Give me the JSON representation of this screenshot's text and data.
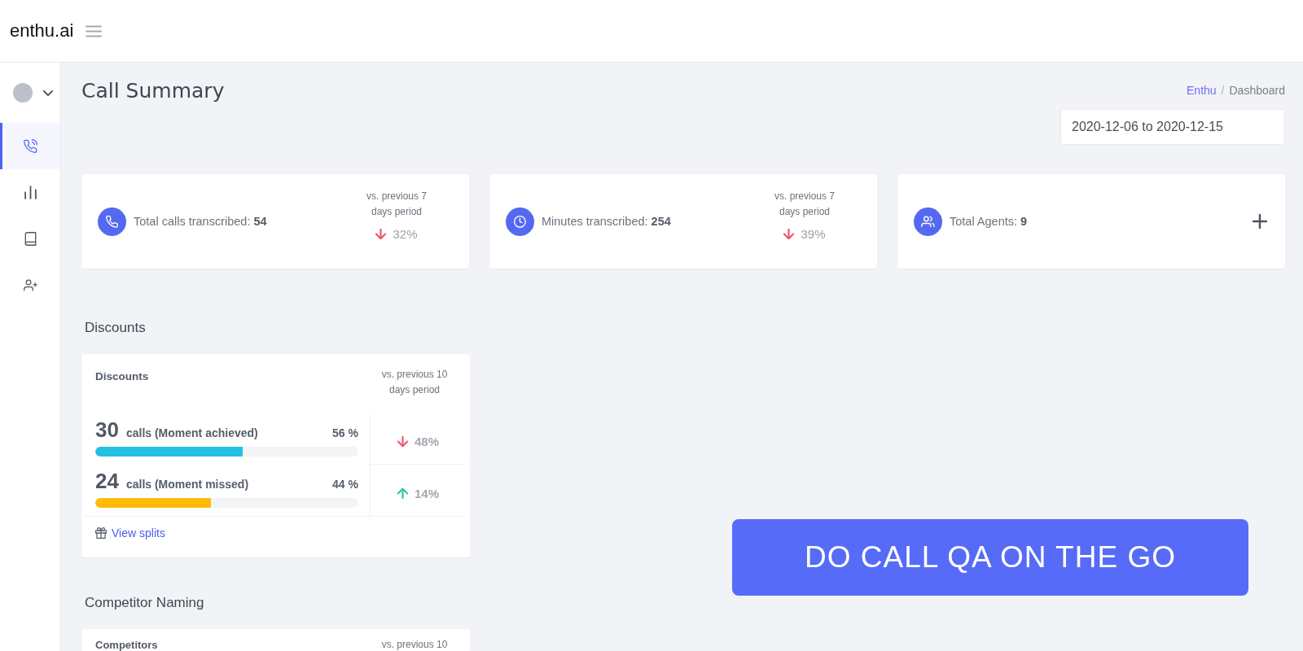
{
  "header": {
    "logo": "enthu.ai"
  },
  "sidebar": {
    "items": [
      {
        "selected": true
      },
      {
        "selected": false
      },
      {
        "selected": false
      },
      {
        "selected": false
      }
    ]
  },
  "page": {
    "title": "Call Summary",
    "breadcrumb": {
      "items": [
        {
          "label": "Enthu",
          "kind": "link"
        },
        {
          "label": "Dashboard",
          "kind": "current"
        }
      ],
      "separator": "/"
    },
    "date_range": {
      "value": "2020-12-06 to 2020-12-15"
    }
  },
  "stats": [
    {
      "kind": "comparison",
      "text": "Total calls transcribed: **54**",
      "comparison": "vs. previous 7 days period",
      "increase": false,
      "change": "32%"
    },
    {
      "kind": "comparison",
      "text": "Minutes transcribed: **254**",
      "comparison": "vs. previous 7 days period",
      "increase": false,
      "change": "39%"
    },
    {
      "kind": "action",
      "text": "Total Agents: **9**"
    }
  ],
  "sections": [
    {
      "heading": "Discounts",
      "card": {
        "title": "Discounts",
        "comparison": "vs. previous 10 days period",
        "rows": [
          {
            "count": "30",
            "label": "calls (Moment achieved)",
            "percent": "56 %",
            "level": 0.56,
            "color": "#22c0e3",
            "increase": false,
            "change": "48%"
          },
          {
            "count": "24",
            "label": "calls (Moment missed)",
            "percent": "44 %",
            "level": 0.44,
            "color": "#ffbb08",
            "increase": true,
            "change": "14%"
          }
        ],
        "link": "View splits"
      }
    },
    {
      "heading": "Competitor Naming",
      "card": {
        "title": "Competitors",
        "comparison": "vs. previous 10"
      }
    }
  ],
  "banner": {
    "label": "DO CALL QA ON THE GO"
  }
}
